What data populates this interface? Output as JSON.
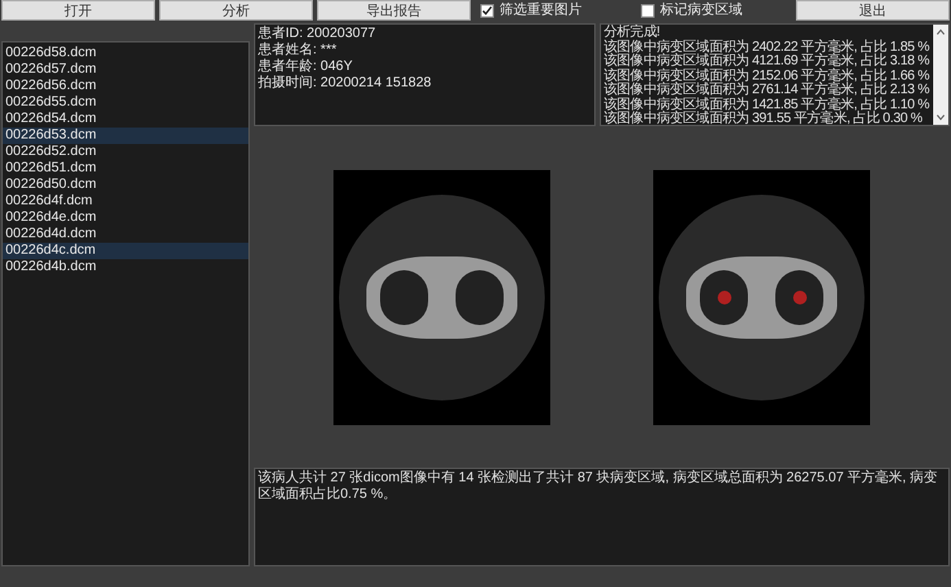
{
  "toolbar": {
    "buttons": [
      {
        "label": "打开",
        "kind": "button"
      },
      {
        "label": "分析",
        "kind": "button"
      },
      {
        "label": "导出报告",
        "kind": "button"
      },
      {
        "label": "筛选重要图片",
        "kind": "checkbox",
        "checked": true
      },
      {
        "label": "标记病变区域",
        "kind": "checkbox",
        "checked": false
      },
      {
        "label": "退出",
        "kind": "button"
      }
    ]
  },
  "file_list": {
    "items": [
      {
        "name": "00226d58.dcm",
        "selected": false
      },
      {
        "name": "00226d57.dcm",
        "selected": false
      },
      {
        "name": "00226d56.dcm",
        "selected": false
      },
      {
        "name": "00226d55.dcm",
        "selected": false
      },
      {
        "name": "00226d54.dcm",
        "selected": false
      },
      {
        "name": "00226d53.dcm",
        "selected": true
      },
      {
        "name": "00226d52.dcm",
        "selected": false
      },
      {
        "name": "00226d51.dcm",
        "selected": false
      },
      {
        "name": "00226d50.dcm",
        "selected": false
      },
      {
        "name": "00226d4f.dcm",
        "selected": false
      },
      {
        "name": "00226d4e.dcm",
        "selected": false
      },
      {
        "name": "00226d4d.dcm",
        "selected": false
      },
      {
        "name": "00226d4c.dcm",
        "selected": true
      },
      {
        "name": "00226d4b.dcm",
        "selected": false
      }
    ]
  },
  "patient_info": [
    "患者ID: 200203077",
    "患者姓名: ***",
    "患者年龄: 046Y",
    "拍摄时间: 20200214 151828"
  ],
  "analysis_log": [
    "分析完成!",
    "该图像中病变区域面积为 2402.22 平方毫米, 占比 1.85 %",
    "该图像中病变区域面积为 4121.69 平方毫米, 占比 3.18 %",
    "该图像中病变区域面积为 2152.06 平方毫米, 占比 1.66 %",
    "该图像中病变区域面积为 2761.14 平方毫米, 占比 2.13 %",
    "该图像中病变区域面积为 1421.85 平方毫米, 占比 1.10 %",
    "该图像中病变区域面积为 391.55 平方毫米, 占比 0.30 %"
  ],
  "images": [
    {
      "marked": false
    },
    {
      "marked": true
    }
  ],
  "summary": "该病人共计 27 张dicom图像中有 14 张检测出了共计 87 块病变区域, 病变区域总面积为 26275.07 平方毫米, 病变区域面积占比0.75 %。"
}
